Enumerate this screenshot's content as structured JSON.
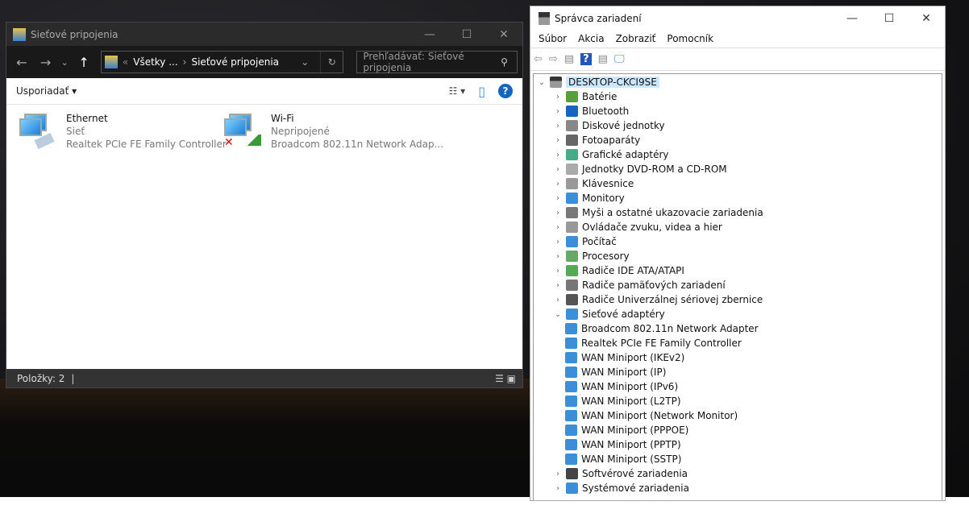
{
  "explorer": {
    "title": "Sieťové pripojenia",
    "controls": [
      "—",
      "☐",
      "✕"
    ],
    "nav": {
      "back": "←",
      "forward": "→",
      "recent": "⌄",
      "up": "↑"
    },
    "breadcrumb": [
      "Všetky ...",
      "Sieťové pripojenia"
    ],
    "breadcrumb_prefix": "«",
    "sep": "›",
    "dropdown": "⌄",
    "refresh": "↻",
    "search_placeholder": "Prehľadávať: Sieťové pripojenia",
    "search_icon": "⚲",
    "organize": "Usporiadať ▾",
    "view_icon": "☷ ▾",
    "pane_icon": "▯",
    "help": "?",
    "connections": [
      {
        "name": "Ethernet",
        "status": "Sieť",
        "device": "Realtek PCIe FE Family Controller"
      },
      {
        "name": "Wi-Fi",
        "status": "Nepripojené",
        "device": "Broadcom 802.11n Network Adap..."
      }
    ],
    "status_items": "Položky: 2",
    "status_icons": "☰ ▣"
  },
  "devmgr": {
    "title": "Správca zariadení",
    "controls": [
      "—",
      "☐",
      "✕"
    ],
    "menu": [
      "Súbor",
      "Akcia",
      "Zobraziť",
      "Pomocník"
    ],
    "toolbar": [
      "⇦",
      "⇨",
      "▤",
      "?",
      "▤",
      "🖵"
    ],
    "root": "DESKTOP-CKCI9SE",
    "categories": [
      {
        "label": "Batérie",
        "color": "#5a9e3a"
      },
      {
        "label": "Bluetooth",
        "color": "#1565c0"
      },
      {
        "label": "Diskové jednotky",
        "color": "#888"
      },
      {
        "label": "Fotoaparáty",
        "color": "#666"
      },
      {
        "label": "Grafické adaptéry",
        "color": "#4a8"
      },
      {
        "label": "Jednotky DVD-ROM a CD-ROM",
        "color": "#aaa"
      },
      {
        "label": "Klávesnice",
        "color": "#999"
      },
      {
        "label": "Monitory",
        "color": "#3a8fd8"
      },
      {
        "label": "Myši a ostatné ukazovacie zariadenia",
        "color": "#777"
      },
      {
        "label": "Ovládače zvuku, videa a hier",
        "color": "#999"
      },
      {
        "label": "Počítač",
        "color": "#3a8fd8"
      },
      {
        "label": "Procesory",
        "color": "#6a6"
      },
      {
        "label": "Radiče IDE ATA/ATAPI",
        "color": "#5a5"
      },
      {
        "label": "Radiče pamäťových zariadení",
        "color": "#777"
      },
      {
        "label": "Radiče Univerzálnej sériovej zbernice",
        "color": "#555"
      }
    ],
    "expanded": {
      "label": "Sieťové adaptéry",
      "color": "#3a8fd8",
      "children": [
        "Broadcom 802.11n Network Adapter",
        "Realtek PCIe FE Family Controller",
        "WAN Miniport (IKEv2)",
        "WAN Miniport (IP)",
        "WAN Miniport (IPv6)",
        "WAN Miniport (L2TP)",
        "WAN Miniport (Network Monitor)",
        "WAN Miniport (PPPOE)",
        "WAN Miniport (PPTP)",
        "WAN Miniport (SSTP)"
      ]
    },
    "after": [
      {
        "label": "Softvérové zariadenia",
        "color": "#444"
      },
      {
        "label": "Systémové zariadenia",
        "color": "#3a8fd8"
      }
    ]
  }
}
